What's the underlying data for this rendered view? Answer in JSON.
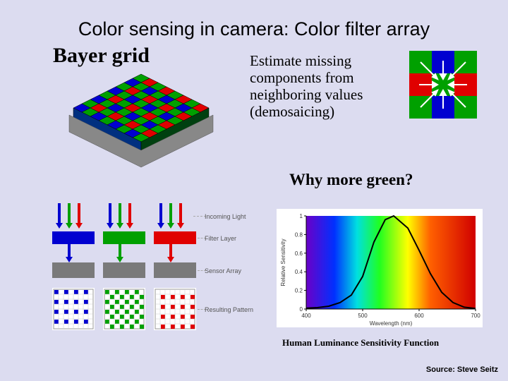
{
  "title": "Color sensing in camera: Color filter array",
  "subtitle": "Bayer grid",
  "demosaic_text": "Estimate missing components from neighboring values (demosaicing)",
  "why_green": "Why more green?",
  "sensitivity_caption": "Human Luminance Sensitivity Function",
  "source": "Source: Steve Seitz",
  "layer_labels": {
    "incoming": "Incoming Light",
    "filter": "Filter Layer",
    "sensor": "Sensor Array",
    "result": "Resulting Pattern"
  },
  "colors": {
    "red": "#e00000",
    "green": "#00a000",
    "blue": "#0000d0",
    "slide_bg": "#dcdcf0",
    "gray": "#7a7a7a"
  },
  "chart_data": {
    "type": "line",
    "title": "Human Luminance Sensitivity Function",
    "xlabel": "Wavelength (nm)",
    "ylabel": "Relative Sensitivity",
    "xlim": [
      400,
      700
    ],
    "ylim": [
      0,
      1
    ],
    "xticks": [
      400,
      500,
      600,
      700
    ],
    "yticks": [
      0,
      0.2,
      0.4,
      0.6,
      0.8,
      1
    ],
    "x": [
      400,
      420,
      440,
      460,
      480,
      500,
      520,
      540,
      555,
      580,
      600,
      620,
      640,
      660,
      680,
      700
    ],
    "y": [
      0.01,
      0.015,
      0.03,
      0.07,
      0.15,
      0.35,
      0.72,
      0.96,
      1.0,
      0.87,
      0.63,
      0.38,
      0.18,
      0.07,
      0.02,
      0.005
    ],
    "background_spectrum": [
      {
        "nm": 400,
        "color": "#6a00c8"
      },
      {
        "nm": 450,
        "color": "#0030ff"
      },
      {
        "nm": 490,
        "color": "#00e0e0"
      },
      {
        "nm": 530,
        "color": "#20ff20"
      },
      {
        "nm": 580,
        "color": "#ffff00"
      },
      {
        "nm": 620,
        "color": "#ff6000"
      },
      {
        "nm": 700,
        "color": "#d00000"
      }
    ]
  }
}
